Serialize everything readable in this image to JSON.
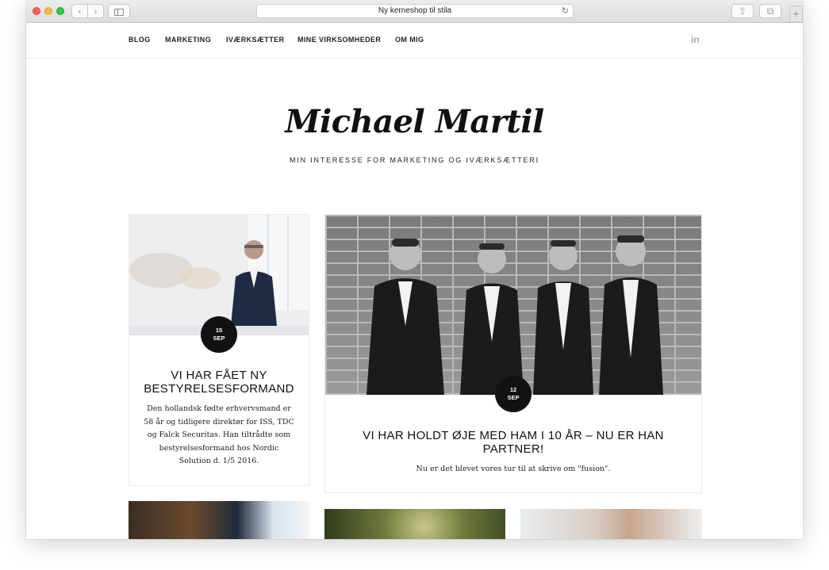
{
  "browser": {
    "address": "Ny kerneshop til stila",
    "reload_glyph": "↻",
    "back_glyph": "‹",
    "forward_glyph": "›",
    "share_glyph": "⇪",
    "tabs_glyph": "⧉",
    "newtab_glyph": "+"
  },
  "nav": {
    "items": [
      {
        "label": "BLOG"
      },
      {
        "label": "MARKETING"
      },
      {
        "label": "IVÆRKSÆTTER"
      },
      {
        "label": "MINE VIRKSOMHEDER"
      },
      {
        "label": "OM MIG"
      }
    ],
    "social": "in"
  },
  "header": {
    "brand": "Michael Martil",
    "tagline": "MIN INTERESSE FOR MARKETING OG IVÆRKSÆTTERI"
  },
  "posts": [
    {
      "day": "15",
      "month": "SEP",
      "title": "VI HAR FÅET NY BESTYRELSESFORMAND",
      "excerpt": "Den hollandsk fødte erhvervsmand er 58 år og tidligere direktør for ISS, TDC og Falck Securitas. Han tiltrådte som bestyrelsesformand hos Nordic Solution d. 1/5 2016."
    },
    {
      "day": "12",
      "month": "SEP",
      "title": "VI HAR HOLDT ØJE MED HAM I 10 ÅR – NU ER HAN PARTNER!",
      "excerpt": "Nu er det blevet vores tur til at skrive om \"fusion\"."
    }
  ]
}
